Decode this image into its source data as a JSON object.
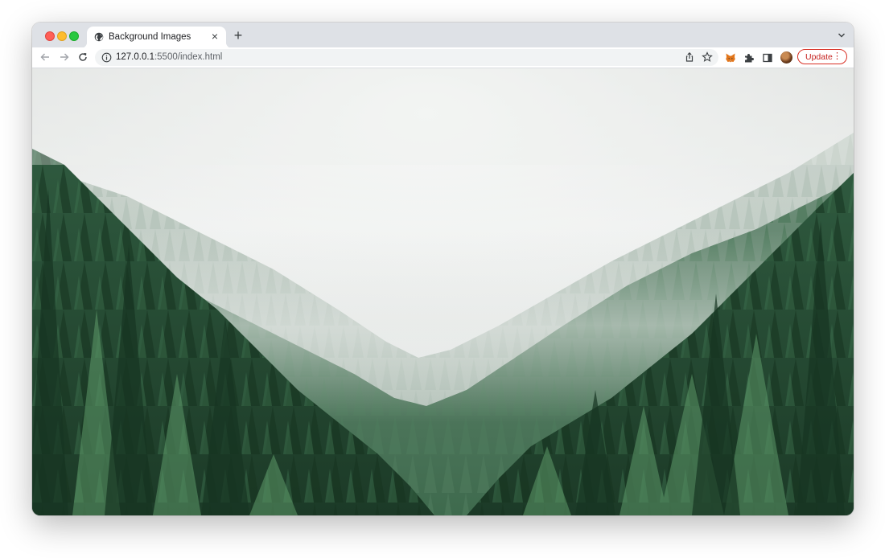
{
  "browser": {
    "tab": {
      "title": "Background Images",
      "favicon": "globe-icon",
      "close_glyph": "×"
    },
    "new_tab_glyph": "+",
    "address_bar": {
      "url_host": "127.0.0.1",
      "url_rest": ":5500/index.html"
    },
    "update_button": {
      "label": "Update",
      "menu_glyph": "⋮",
      "accent": "#d93025"
    },
    "toolbar_icons": [
      "back-arrow-icon",
      "forward-arrow-icon",
      "reload-icon",
      "info-icon",
      "share-icon",
      "star-icon",
      "metamask-fox-icon",
      "extensions-puzzle-icon",
      "side-panel-icon",
      "profile-avatar"
    ]
  },
  "page": {
    "background_image": "misty-pine-forest-photo",
    "colors": {
      "fog": "#e9ebea",
      "forest_dark": "#1e3f2c",
      "forest_mid": "#2f5a3f",
      "forest_light": "#4f8a5c"
    }
  }
}
